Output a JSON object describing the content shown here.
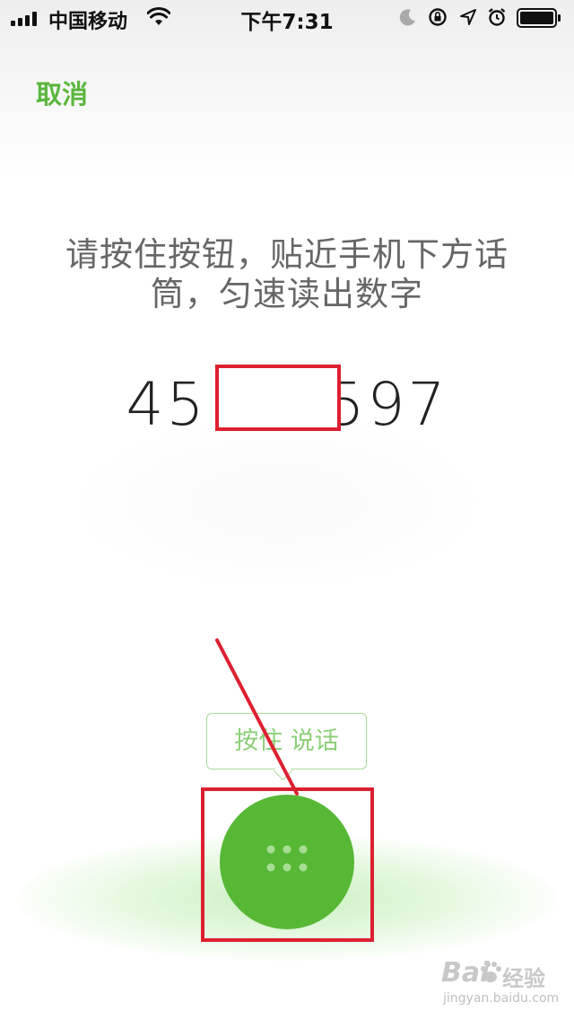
{
  "status_bar": {
    "carrier": "中国移动",
    "time": "下午7:31"
  },
  "header": {
    "cancel_label": "取消"
  },
  "main": {
    "instruction": "请按住按钮，贴近手机下方话筒，匀速读出数字",
    "digits_prefix": "45",
    "digits_suffix": "597"
  },
  "record": {
    "tooltip": "按住 说话"
  },
  "watermark": {
    "logo": "Bai",
    "logo_suffix": "经验",
    "url": "jingyan.baidu.com"
  },
  "colors": {
    "accent": "#57b835",
    "annotation": "#dd2030"
  },
  "icons": [
    "signal-icon",
    "wifi-icon",
    "moon-icon",
    "rotation-lock-icon",
    "location-icon",
    "alarm-icon",
    "battery-icon",
    "dots-icon",
    "baidu-paw-icon"
  ]
}
